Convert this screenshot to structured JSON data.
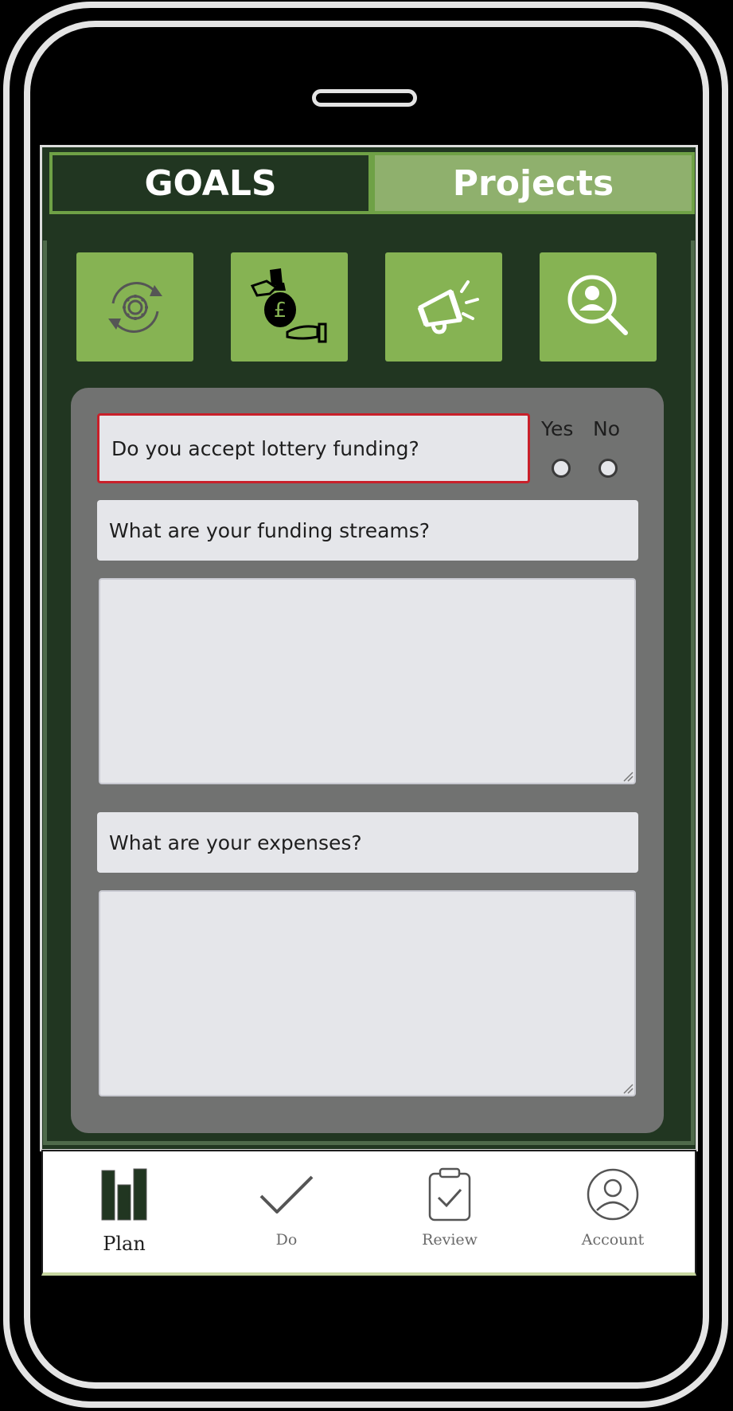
{
  "tabs": {
    "goals": "GOALS",
    "projects": "Projects"
  },
  "category_icons": [
    "settings-cycle-icon",
    "funding-money-bag-icon",
    "megaphone-icon",
    "user-search-icon"
  ],
  "form": {
    "lottery_question": "Do you accept lottery funding?",
    "lottery_options": {
      "yes": "Yes",
      "no": "No"
    },
    "funding_streams_question": "What are your funding streams?",
    "funding_streams_value": "",
    "expenses_question": "What are your expenses?",
    "expenses_value": ""
  },
  "bottom_nav": {
    "items": [
      {
        "label": "Plan",
        "icon": "bar-chart-icon",
        "active": true
      },
      {
        "label": "Do",
        "icon": "checkmark-icon",
        "active": false
      },
      {
        "label": "Review",
        "icon": "clipboard-check-icon",
        "active": false
      },
      {
        "label": "Account",
        "icon": "user-circle-icon",
        "active": false
      }
    ]
  },
  "colors": {
    "screen_bg": "#213621",
    "tile_green": "#86b353",
    "projects_tab": "#8fb06d",
    "panel_gray": "#717271",
    "field_bg": "#e5e6ea",
    "error_border": "#c8202a"
  }
}
